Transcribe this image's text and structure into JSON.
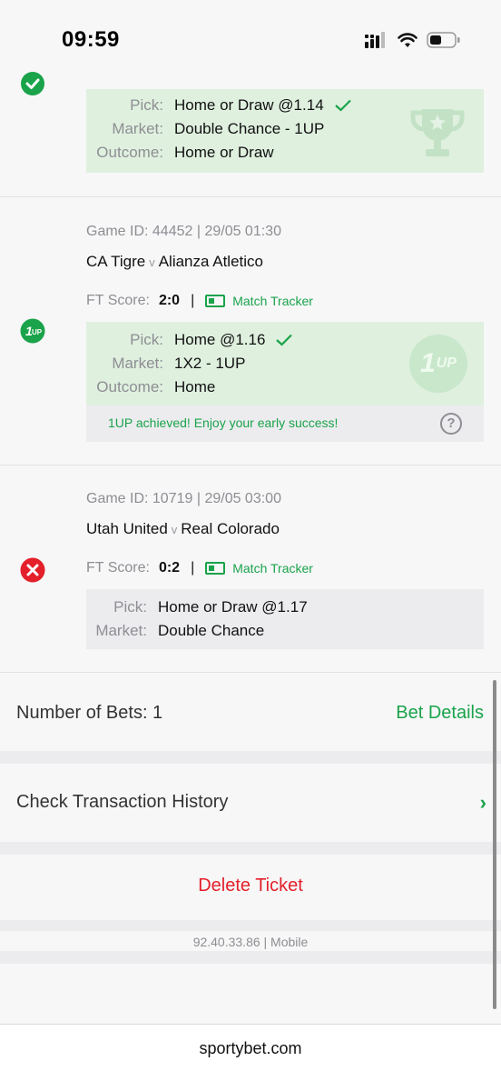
{
  "status_bar": {
    "time": "09:59"
  },
  "bet1": {
    "pick_label": "Pick:",
    "pick_value": "Home or Draw @1.14",
    "market_label": "Market:",
    "market_value": "Double Chance - 1UP",
    "outcome_label": "Outcome:",
    "outcome_value": "Home or Draw",
    "status": "won"
  },
  "bet2": {
    "game_id": "Game ID: 44452 | 29/05 01:30",
    "home": "CA Tigre",
    "vs": "v",
    "away": "Alianza Atletico",
    "ft_label": "FT Score:",
    "ft_score": "2:0",
    "sep": "|",
    "tracker": "Match Tracker",
    "badge": "1UP",
    "pick_label": "Pick:",
    "pick_value": "Home @1.16",
    "market_label": "Market:",
    "market_value": "1X2 - 1UP",
    "outcome_label": "Outcome:",
    "outcome_value": "Home",
    "achieved": "1UP achieved! Enjoy your early success!",
    "help": "?"
  },
  "bet3": {
    "game_id": "Game ID: 10719 | 29/05 03:00",
    "home": "Utah United",
    "vs": "v",
    "away": "Real Colorado",
    "ft_label": "FT Score:",
    "ft_score": "0:2",
    "sep": "|",
    "tracker": "Match Tracker",
    "pick_label": "Pick:",
    "pick_value": "Home or Draw @1.17",
    "market_label": "Market:",
    "market_value": "Double Chance",
    "status": "lost"
  },
  "summary": {
    "num_bets": "Number of Bets: 1",
    "bet_details": "Bet Details"
  },
  "transaction": {
    "label": "Check Transaction History",
    "chevron": "›"
  },
  "delete": {
    "label": "Delete Ticket"
  },
  "meta": {
    "ip": "92.40.33.86 | Mobile"
  },
  "footer": {
    "url": "sportybet.com"
  },
  "colors": {
    "green": "#1aa34a",
    "red": "#e4202a",
    "pick_green_bg": "#dff0df",
    "pick_grey_bg": "#ececef"
  }
}
